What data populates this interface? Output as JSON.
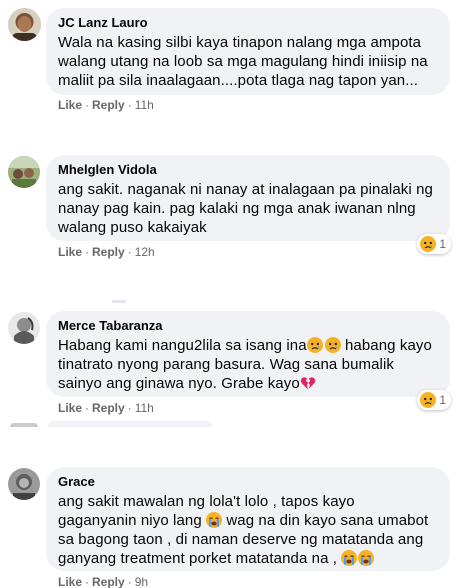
{
  "comments": [
    {
      "author": "JC Lanz Lauro",
      "text": "Wala na kasing silbi kaya tinapon nalang mga ampota\nwalang utang na loob sa mga magulang hindi iniisip na\nmaliit pa sila inaalagaan....pota tlaga nag tapon yan...",
      "like": "Like",
      "reply": "Reply",
      "time": "11h"
    },
    {
      "author": "Mhelglen Vidola",
      "text": "ang sakit. naganak ni nanay at inalagaan pa pinalaki ng\nnanay pag kain. pag kalaki ng mga anak iwanan nlng\nwalang puso kakaiyak",
      "like": "Like",
      "reply": "Reply",
      "time": "12h",
      "reaction_count": "1",
      "reaction_icon": "sad-emoji-icon"
    },
    {
      "author": "Merce Tabaranza",
      "text_part1": "Habang kami nangu2lila sa isang ina",
      "text_part2": " habang kayo",
      "text_line2": "tinatrato nyong parang basura. Wag sana bumalik",
      "text_line3": "sainyo ang ginawa nyo. Grabe kayo",
      "like": "Like",
      "reply": "Reply",
      "time": "11h",
      "reaction_count": "1",
      "reaction_icon": "sad-emoji-icon"
    },
    {
      "author": "Grace",
      "line1": "ang sakit mawalan ng lola't lolo , tapos kayo",
      "line2a": "gaganyanin niyo lang ",
      "line2b": " wag na din kayo sana umabot",
      "line3": "sa bagong taon , di naman deserve ng matatanda ang",
      "line4": "ganyang treatment porket matatanda na , ",
      "like": "Like",
      "reply": "Reply",
      "time": "9h"
    }
  ],
  "separator": "·",
  "colors": {
    "bubble": "#f0f2f5",
    "meta_text": "#65676b",
    "body_text": "#050505",
    "sad_emoji": "#f7b125",
    "broken_heart": "#e0245e"
  }
}
